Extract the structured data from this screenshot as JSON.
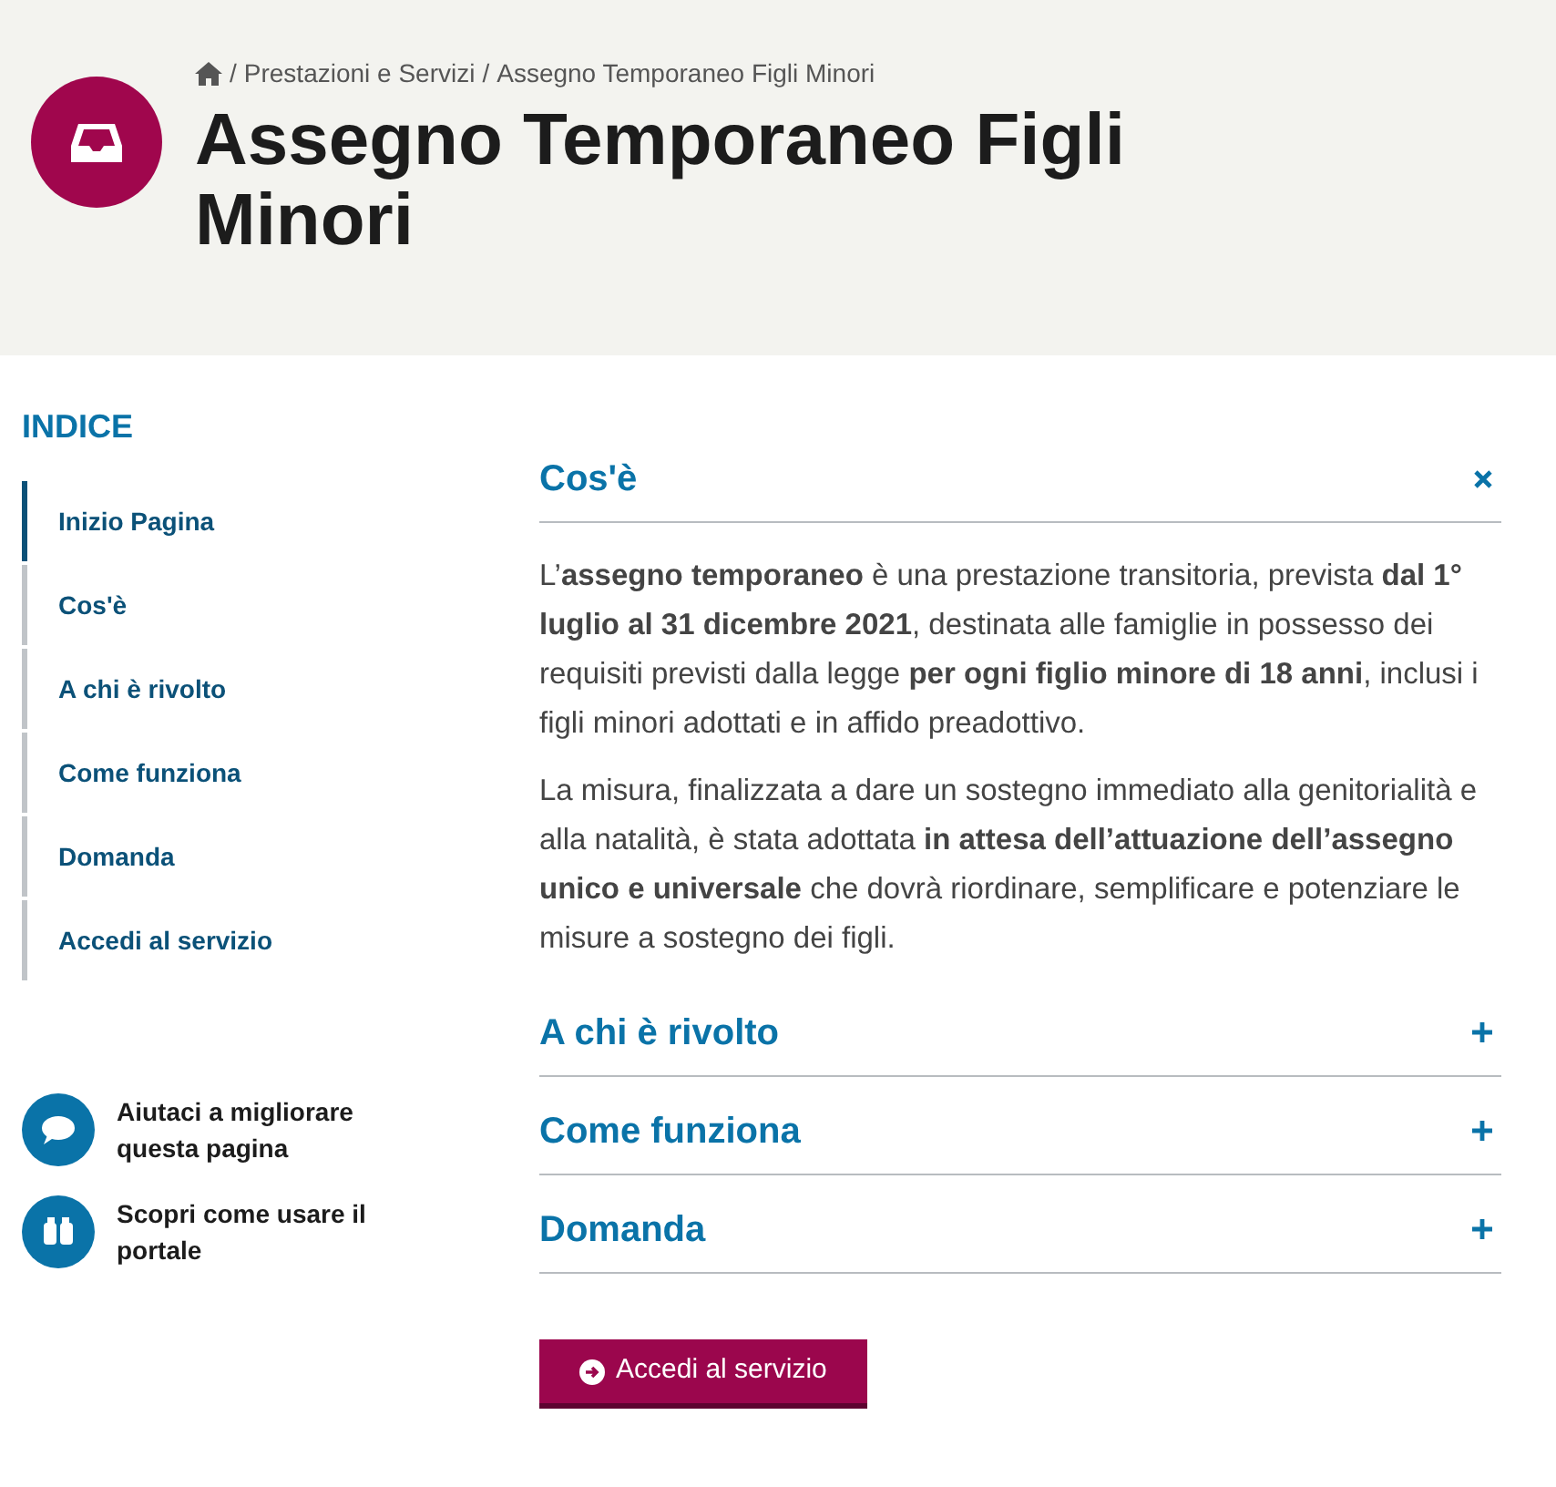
{
  "breadcrumb_separator": "/",
  "breadcrumb": [
    "Prestazioni e Servizi",
    "Assegno Temporaneo Figli Minori"
  ],
  "title": "Assegno Temporaneo Figli Minori",
  "index": {
    "heading": "INDICE",
    "items": [
      {
        "label": "Inizio Pagina",
        "selected": true
      },
      {
        "label": "Cos'è",
        "selected": false
      },
      {
        "label": "A chi è rivolto",
        "selected": false
      },
      {
        "label": "Come funziona",
        "selected": false
      },
      {
        "label": "Domanda",
        "selected": false
      },
      {
        "label": "Accedi al servizio",
        "selected": false
      }
    ]
  },
  "help_links": [
    {
      "kind": "feedback",
      "label": "Aiutaci a migliorare questa pagina"
    },
    {
      "kind": "guide",
      "label": "Scopri come usare il portale"
    }
  ],
  "sections": [
    {
      "title": "Cos'è",
      "expanded": true,
      "paragraphs": [
        "L’**assegno temporaneo** è una prestazione transitoria, prevista **dal 1° luglio al 31 dicembre 2021**, destinata alle famiglie in possesso dei requisiti previsti dalla legge **per ogni figlio minore di 18 anni**, inclusi i figli minori adottati e in affido preadottivo.",
        "La misura, finalizzata a dare un sostegno immediato alla genitorialità e alla natalità, è stata adottata **in attesa dell’attuazione dell’assegno unico e universale** che dovrà riordinare, semplificare e potenziare le misure a sostegno dei figli."
      ]
    },
    {
      "title": "A chi è rivolto",
      "expanded": false
    },
    {
      "title": "Come funziona",
      "expanded": false
    },
    {
      "title": "Domanda",
      "expanded": false
    }
  ],
  "action_button": "Accedi al servizio"
}
